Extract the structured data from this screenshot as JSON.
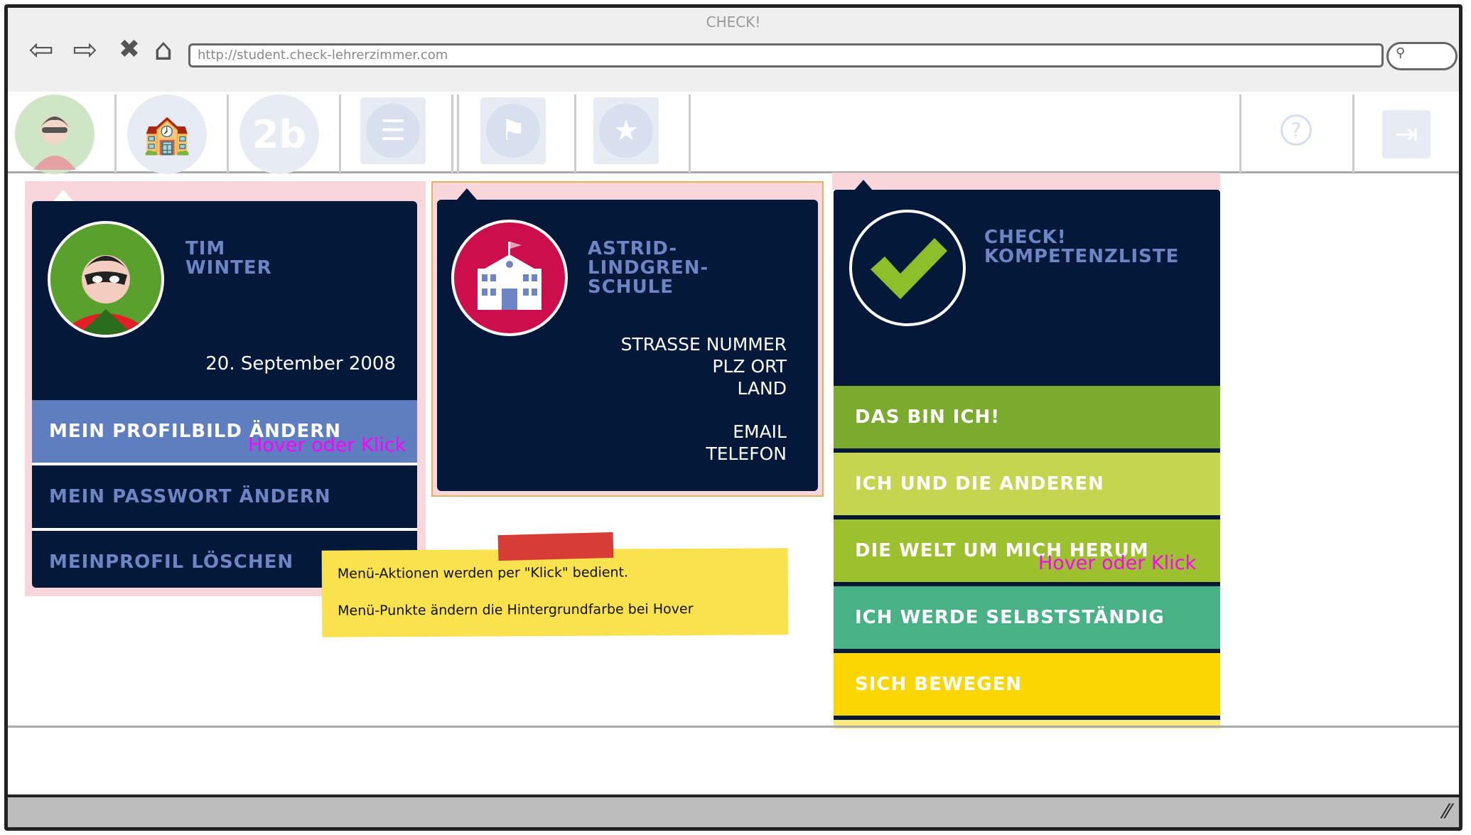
{
  "browser": {
    "window_title": "CHECK!",
    "url": "http://student.check-lehrerzimmer.com",
    "nav_icons": [
      "back-icon",
      "forward-icon",
      "stop-icon",
      "home-icon"
    ]
  },
  "toolbar": {
    "class_label": "2b"
  },
  "profile": {
    "name_line1": "TIM",
    "name_line2": "WINTER",
    "birthdate": "20. September 2008",
    "menu": [
      {
        "label": "MEIN PROFILBILD ÄNDERN"
      },
      {
        "label": "MEIN PASSWORT ÄNDERN"
      },
      {
        "label": "MEINPROFIL LÖSCHEN"
      }
    ],
    "hover_note": "Hover oder Klick"
  },
  "school": {
    "name_line1": "ASTRID-",
    "name_line2": "LINDGREN-",
    "name_line3": "SCHULE",
    "street": "STRASSE NUMMER",
    "city": "PLZ ORT",
    "country": "LAND",
    "email": "EMAIL",
    "phone": "TELEFON"
  },
  "competence": {
    "title_line1": "CHECK!",
    "title_line2": "KOMPETENZLISTE",
    "items": [
      {
        "label": "DAS BIN ICH!",
        "color": "#7aab2f"
      },
      {
        "label": "ICH UND DIE ANDEREN",
        "color": "#c5d54f"
      },
      {
        "label": "DIE WELT UM MICH HERUM",
        "color": "#9dc12e"
      },
      {
        "label": "ICH WERDE SELBSTSTÄNDIG",
        "color": "#48b286"
      },
      {
        "label": "SICH BEWEGEN",
        "color": "#fbd600"
      }
    ],
    "hover_note": "Hover oder Klick"
  },
  "sticky_note": {
    "line1": "Menü-Aktionen werden per \"Klick\" bedient.",
    "line2": "Menü-Punkte ändern die Hintergrundfarbe bei Hover"
  },
  "colors": {
    "navy": "#04193a",
    "accent_blue": "#5f7ec0",
    "pink_bg": "#f9d5dc",
    "school_red": "#cc0f4c",
    "avatar_green": "#5aa02c"
  }
}
